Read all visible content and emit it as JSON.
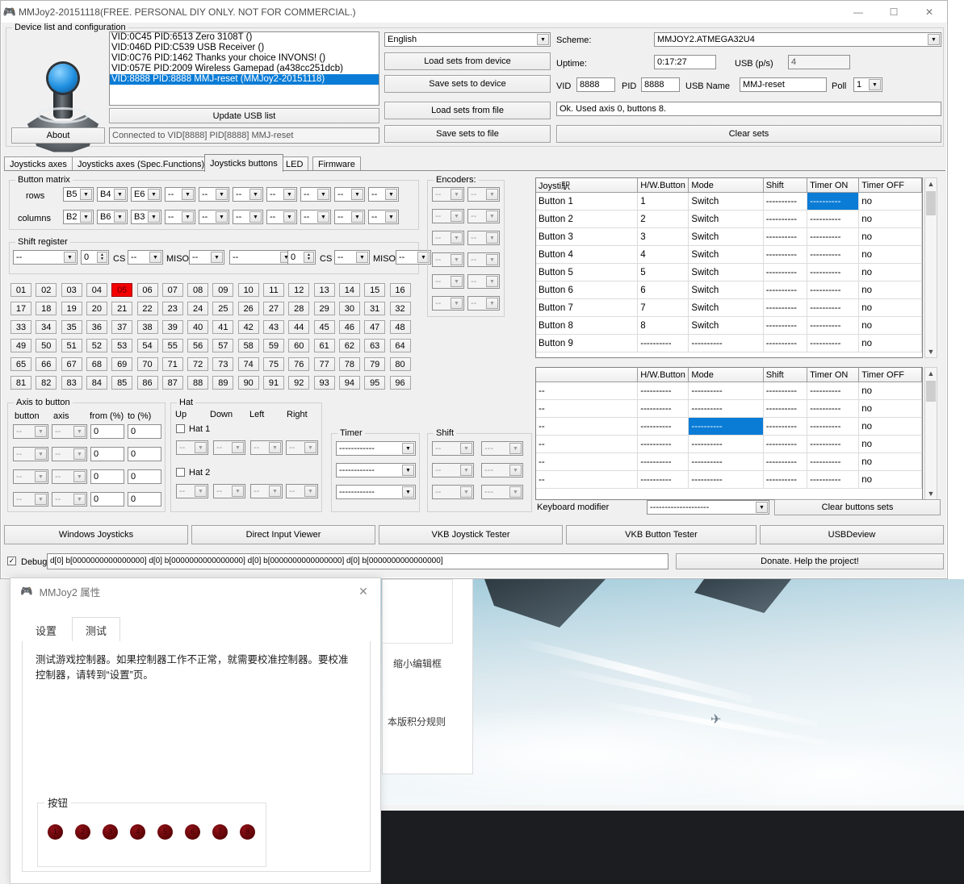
{
  "window": {
    "title": "MMJoy2-20151118(FREE. PERSONAL DIY ONLY. NOT FOR COMMERCIAL.)",
    "icon": "joystick-icon",
    "minimize": "—",
    "maximize": "☐",
    "close": "✕"
  },
  "device_group": {
    "legend": "Device list and configuration",
    "about_button": "About",
    "update_usb_button": "Update USB list",
    "status": "Connected to VID[8888] PID[8888] MMJ-reset",
    "devices": [
      {
        "text": "VID:0C45 PID:6513 Zero 3108T ()",
        "selected": false
      },
      {
        "text": "VID:046D PID:C539 USB Receiver ()",
        "selected": false
      },
      {
        "text": "VID:0C76 PID:1462 Thanks your choice INVONS! ()",
        "selected": false
      },
      {
        "text": "VID:057E PID:2009 Wireless Gamepad (a438cc251dcb)",
        "selected": false
      },
      {
        "text": "VID:8888 PID:8888 MMJ-reset (MMJoy2-20151118)",
        "selected": true
      }
    ]
  },
  "sets_buttons": {
    "load_from_device": "Load sets from device",
    "save_to_device": "Save sets to device",
    "load_from_file": "Load sets from file",
    "save_to_file": "Save sets to file"
  },
  "config": {
    "language": "English",
    "scheme_label": "Scheme:",
    "scheme": "MMJOY2.ATMEGA32U4",
    "uptime_label": "Uptime:",
    "uptime": "0:17:27",
    "usb_ps_label": "USB (p/s)",
    "usb_ps": "4",
    "vid_label": "VID",
    "vid": "8888",
    "pid_label": "PID",
    "pid": "8888",
    "usb_name_label": "USB Name",
    "usb_name": "MMJ-reset",
    "poll_label": "Poll",
    "poll": "1",
    "status": "Ok. Used axis  0, buttons 8.",
    "clear_sets_button": "Clear sets"
  },
  "tabs": [
    {
      "label": "Joysticks axes",
      "active": false
    },
    {
      "label": "Joysticks axes (Spec.Functions)",
      "active": false
    },
    {
      "label": "Joysticks buttons",
      "active": true
    },
    {
      "label": "LED",
      "active": false
    },
    {
      "label": "Firmware",
      "active": false
    }
  ],
  "button_matrix": {
    "legend": "Button matrix",
    "rows_label": "rows",
    "columns_label": "columns",
    "rows": [
      "B5",
      "B4",
      "E6",
      "--",
      "--",
      "--",
      "--",
      "--",
      "--",
      "--"
    ],
    "columns": [
      "B2",
      "B6",
      "B3",
      "--",
      "--",
      "--",
      "--",
      "--",
      "--",
      "--"
    ]
  },
  "shift_register": {
    "legend": "Shift register",
    "cs_label": "CS",
    "miso_label": "MISO",
    "groups": [
      {
        "pin": "--",
        "count": "0",
        "cs": "--",
        "miso": "--"
      },
      {
        "pin": "--",
        "count": "0",
        "cs": "--",
        "miso": "--"
      }
    ]
  },
  "keypad": {
    "cells": [
      "01",
      "02",
      "03",
      "04",
      "05",
      "06",
      "07",
      "08",
      "09",
      "10",
      "11",
      "12",
      "13",
      "14",
      "15",
      "16",
      "17",
      "18",
      "19",
      "20",
      "21",
      "22",
      "23",
      "24",
      "25",
      "26",
      "27",
      "28",
      "29",
      "30",
      "31",
      "32",
      "33",
      "34",
      "35",
      "36",
      "37",
      "38",
      "39",
      "40",
      "41",
      "42",
      "43",
      "44",
      "45",
      "46",
      "47",
      "48",
      "49",
      "50",
      "51",
      "52",
      "53",
      "54",
      "55",
      "56",
      "57",
      "58",
      "59",
      "60",
      "61",
      "62",
      "63",
      "64",
      "65",
      "66",
      "67",
      "68",
      "69",
      "70",
      "71",
      "72",
      "73",
      "74",
      "75",
      "76",
      "77",
      "78",
      "79",
      "80",
      "81",
      "82",
      "83",
      "84",
      "85",
      "86",
      "87",
      "88",
      "89",
      "90",
      "91",
      "92",
      "93",
      "94",
      "95",
      "96"
    ],
    "active_index": 4,
    "active_color": "#f40000"
  },
  "axis_to_button": {
    "legend": "Axis to button",
    "headers": [
      "button",
      "axis",
      "from (%)",
      "to (%)"
    ],
    "rows": [
      {
        "button": "--",
        "axis": "--",
        "from": "0",
        "to": "0"
      },
      {
        "button": "--",
        "axis": "--",
        "from": "0",
        "to": "0"
      },
      {
        "button": "--",
        "axis": "--",
        "from": "0",
        "to": "0"
      },
      {
        "button": "--",
        "axis": "--",
        "from": "0",
        "to": "0"
      }
    ]
  },
  "hat": {
    "legend": "Hat",
    "headers": [
      "Up",
      "Down",
      "Left",
      "Right"
    ],
    "hat1_label": "Hat 1",
    "hat2_label": "Hat 2",
    "hat1_checked": false,
    "hat2_checked": false,
    "hat1_values": [
      "--",
      "--",
      "--",
      "--"
    ],
    "hat2_values": [
      "--",
      "--",
      "--",
      "--"
    ]
  },
  "encoders": {
    "legend": "Encoders:",
    "rows": [
      [
        "--",
        "--"
      ],
      [
        "--",
        "--"
      ],
      [
        "--",
        "--"
      ],
      [
        "--",
        "--"
      ],
      [
        "--",
        "--"
      ],
      [
        "--",
        "--"
      ]
    ]
  },
  "timer_group": {
    "legend": "Timer",
    "values": [
      "------------",
      "------------",
      "------------"
    ]
  },
  "shift_group": {
    "legend": "Shift",
    "rows": [
      [
        "--",
        "---"
      ],
      [
        "--",
        "---"
      ],
      [
        "--",
        "---"
      ]
    ]
  },
  "buttons_table": {
    "headers": [
      "Joysti駅",
      "H/W.Button",
      "Mode",
      "Shift",
      "Timer ON",
      "Timer OFF"
    ],
    "selected_cell": {
      "row": 0,
      "col": 4
    },
    "rows": [
      {
        "name": "Button 1",
        "hw": "1",
        "mode": "Switch",
        "shift": "----------",
        "timer_on": "----------",
        "timer_off": "no"
      },
      {
        "name": "Button 2",
        "hw": "2",
        "mode": "Switch",
        "shift": "----------",
        "timer_on": "----------",
        "timer_off": "no"
      },
      {
        "name": "Button 3",
        "hw": "3",
        "mode": "Switch",
        "shift": "----------",
        "timer_on": "----------",
        "timer_off": "no"
      },
      {
        "name": "Button 4",
        "hw": "4",
        "mode": "Switch",
        "shift": "----------",
        "timer_on": "----------",
        "timer_off": "no"
      },
      {
        "name": "Button 5",
        "hw": "5",
        "mode": "Switch",
        "shift": "----------",
        "timer_on": "----------",
        "timer_off": "no"
      },
      {
        "name": "Button 6",
        "hw": "6",
        "mode": "Switch",
        "shift": "----------",
        "timer_on": "----------",
        "timer_off": "no"
      },
      {
        "name": "Button 7",
        "hw": "7",
        "mode": "Switch",
        "shift": "----------",
        "timer_on": "----------",
        "timer_off": "no"
      },
      {
        "name": "Button 8",
        "hw": "8",
        "mode": "Switch",
        "shift": "----------",
        "timer_on": "----------",
        "timer_off": "no"
      },
      {
        "name": "Button 9",
        "hw": "----------",
        "mode": "----------",
        "shift": "----------",
        "timer_on": "----------",
        "timer_off": "no"
      }
    ]
  },
  "logical_table": {
    "headers": [
      "",
      "H/W.Button",
      "Mode",
      "Shift",
      "Timer ON",
      "Timer OFF"
    ],
    "selected_cell": {
      "row": 2,
      "col": 2
    },
    "rows": [
      {
        "name": "--",
        "hw": "----------",
        "mode": "----------",
        "shift": "----------",
        "timer_on": "----------",
        "timer_off": "no"
      },
      {
        "name": "--",
        "hw": "----------",
        "mode": "----------",
        "shift": "----------",
        "timer_on": "----------",
        "timer_off": "no"
      },
      {
        "name": "--",
        "hw": "----------",
        "mode": "----------",
        "shift": "----------",
        "timer_on": "----------",
        "timer_off": "no"
      },
      {
        "name": "--",
        "hw": "----------",
        "mode": "----------",
        "shift": "----------",
        "timer_on": "----------",
        "timer_off": "no"
      },
      {
        "name": "--",
        "hw": "----------",
        "mode": "----------",
        "shift": "----------",
        "timer_on": "----------",
        "timer_off": "no"
      },
      {
        "name": "--",
        "hw": "----------",
        "mode": "----------",
        "shift": "----------",
        "timer_on": "----------",
        "timer_off": "no"
      }
    ]
  },
  "keyboard_modifier": {
    "label": "Keyboard modifier",
    "value": "--------------------",
    "clear_button": "Clear buttons sets"
  },
  "toolbar": {
    "windows_joysticks": "Windows Joysticks",
    "direct_input_viewer": "Direct Input Viewer",
    "vkb_joystick_tester": "VKB Joystick Tester",
    "vkb_button_tester": "VKB Button Tester",
    "usbdeview": "USBDeview"
  },
  "debug": {
    "label": "Debug",
    "checked": true,
    "check_glyph": "✓",
    "value": "d[0] b[0000000000000000]   d[0] b[0000000000000000]   d[0] b[0000000000000000]   d[0] b[0000000000000000]",
    "donate_button": "Donate. Help the project!"
  },
  "props_dialog": {
    "title": "MMJoy2 属性",
    "close": "✕",
    "tabs": [
      {
        "label": "设置",
        "active": false
      },
      {
        "label": "测试",
        "active": true
      }
    ],
    "description": "测试游戏控制器。如果控制器工作不正常，就需要校准控制器。要校准控制器，请转到“设置”页。",
    "buttons_legend": "按钮",
    "buttons": [
      "1",
      "2",
      "3",
      "4",
      "5",
      "6",
      "7",
      "8"
    ]
  },
  "background": {
    "panel_text_1": "缩小编辑框",
    "panel_text_2": "本版积分规则"
  }
}
